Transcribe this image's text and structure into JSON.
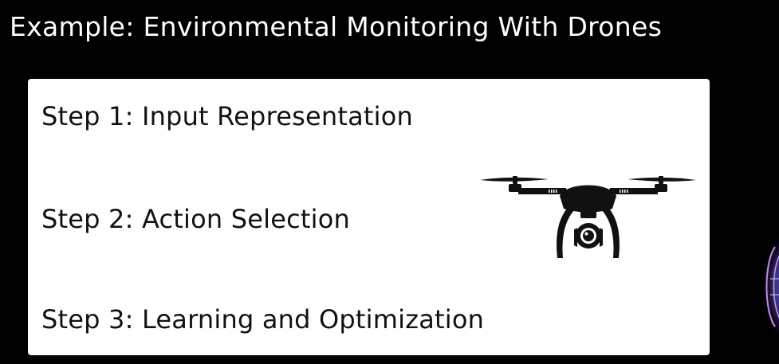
{
  "title": "Example: Environmental Monitoring With Drones",
  "steps": [
    {
      "label": "Step 1: Input Representation"
    },
    {
      "label": "Step 2: Action Selection"
    },
    {
      "label": "Step 3: Learning and Optimization"
    }
  ],
  "icons": {
    "drone": "drone-icon",
    "edge_graphic": "glowing-circuit-graphic"
  },
  "colors": {
    "background": "#000000",
    "card": "#ffffff",
    "text_dark": "#111111",
    "text_light": "#ffffff",
    "icon": "#111111",
    "glow_purple": "#7b3fc4",
    "glow_blue": "#3f7ce0"
  }
}
